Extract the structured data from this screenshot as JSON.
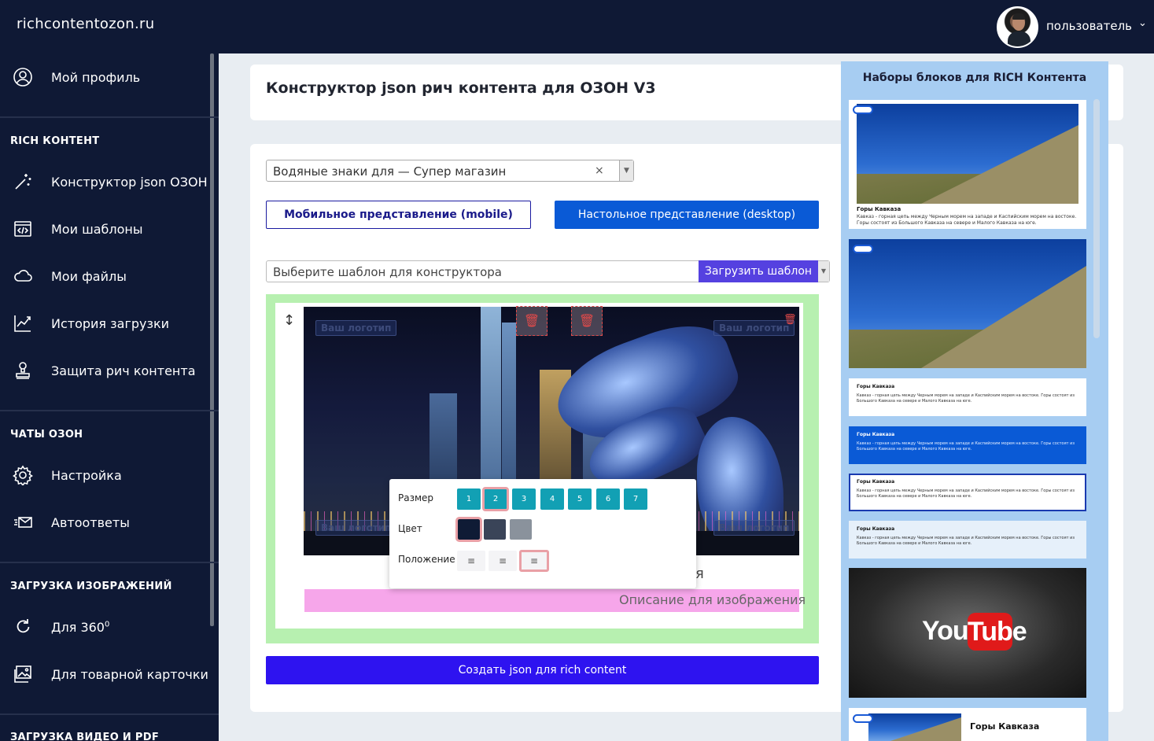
{
  "topbar": {
    "logo": "richcontentozon.ru",
    "username": "пользователь"
  },
  "sidebar": {
    "profile": "Мой профиль",
    "section_rich": "RICH КОНТЕНТ",
    "rich_items": [
      "Конструктор json ОЗОН",
      "Мои шаблоны",
      "Мои файлы",
      "История загрузки",
      "Защита рич контента"
    ],
    "section_chats": "ЧАТЫ ОЗОН",
    "chat_items": [
      "Настройка",
      "Автоответы"
    ],
    "section_images": "ЗАГРУЗКА ИЗОБРАЖЕНИЙ",
    "image_items": [
      "Для 360",
      "Для товарной карточки"
    ],
    "image_360_sup": "0",
    "section_video": "ЗАГРУЗКА ВИДЕО И PDF"
  },
  "main": {
    "title": "Конструктор json рич контента для ОЗОН V3",
    "watermark_select": "Водяные знаки для — Супер магазин",
    "clear_symbol": "×",
    "btn_mobile": "Мобильное представление (mobile)",
    "btn_desktop": "Настольное представление (desktop)",
    "template_placeholder": "Выберите шаблон для конструктора",
    "btn_load": "Загрузить шаблон",
    "logo_placeholder_1": "Ваш логотип",
    "logo_placeholder_2": "Ваш логотип",
    "logo_placeholder_3": "Ваш логотип",
    "logo_placeholder_4": "Ваш логотип",
    "hidden_char": "я",
    "image_description": "Описание для изображения",
    "btn_create": "Создать json для rich content"
  },
  "popup": {
    "size_label": "Размер",
    "sizes": [
      "1",
      "2",
      "3",
      "4",
      "5",
      "6",
      "7"
    ],
    "selected_size": "2",
    "color_label": "Цвет",
    "colors": [
      "#0f1b35",
      "#3a4458",
      "#8a929c"
    ],
    "position_label": "Положение",
    "positions": [
      "≡",
      "≡",
      "≡"
    ],
    "selected_position": "right"
  },
  "right_panel": {
    "title": "Наборы блоков для RICH Контента",
    "block_title": "Горы Кавказа",
    "block_text": "Кавказ - горная цепь между Черным морем на западе и Каспийским морем на востоке. Горы состоят из Большого Кавказа на севере и Малого Кавказа на юге.",
    "last_title": "Горы Кавказа",
    "yt_you": "You",
    "yt_tube": "Tube"
  },
  "colors": {
    "brand_dark": "#0f1935",
    "accent_blue": "#0a5ad6",
    "create_blue": "#2e13f0",
    "teal": "#12a0b4"
  }
}
